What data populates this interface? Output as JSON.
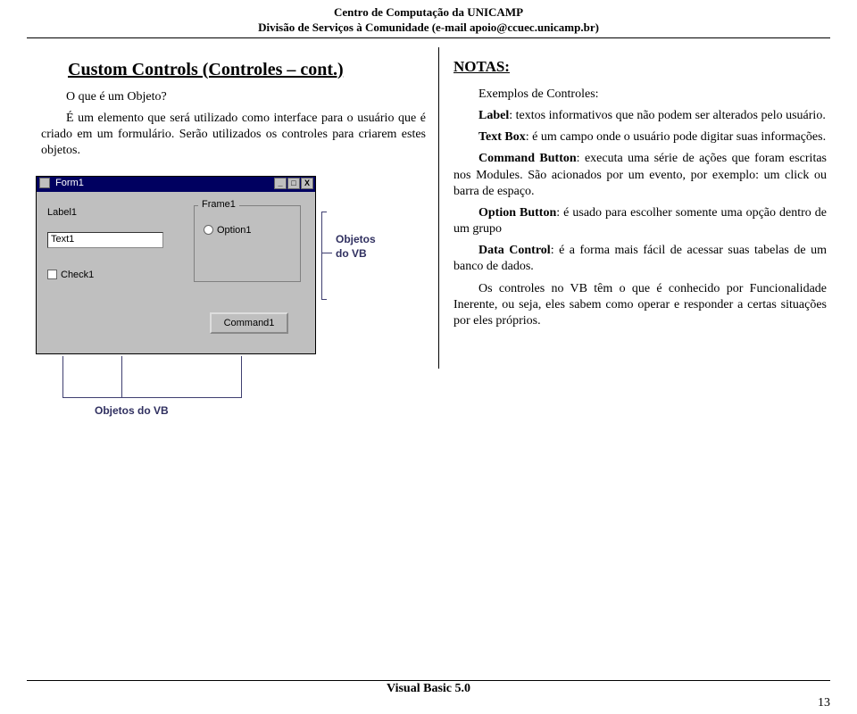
{
  "header": {
    "line1": "Centro de Computação da UNICAMP",
    "line2": "Divisão de Serviços à Comunidade (e-mail apoio@ccuec.unicamp.br)"
  },
  "left": {
    "title": "Custom Controls (Controles – cont.)",
    "q": "O que é um Objeto?",
    "body": "É um elemento que será utilizado como interface para o usuário que é criado em um formulário. Serão utilizados os controles para criarem estes objetos.",
    "shot": {
      "form_title": "Form1",
      "min": "_",
      "max": "□",
      "close": "X",
      "label": "Label1",
      "textbox": "Text1",
      "frame": "Frame1",
      "option": "Option1",
      "check": "Check1",
      "button": "Command1",
      "annot1a": "Objetos",
      "annot1b": "do VB",
      "annot2": "Objetos do VB"
    }
  },
  "right": {
    "title": "NOTAS:",
    "intro": "Exemplos de Controles:",
    "label_b": "Label",
    "label_t": ": textos informativos que não podem ser alterados pelo usuário.",
    "text_b": "Text Box",
    "text_t": ": é um campo onde o usuário pode digitar suas informações.",
    "cmd_b": "Command Button",
    "cmd_t": ": executa uma série de ações que foram escritas nos Modules. São acionados por um evento, por exemplo: um click ou barra de espaço.",
    "opt_b": "Option Button",
    "opt_t": ": é usado para escolher somente uma opção dentro de um grupo",
    "data_b": "Data Control",
    "data_t": ": é a forma mais fácil de acessar suas tabelas de um banco de dados.",
    "last": "Os controles no VB têm o que é conhecido por Funcionalidade Inerente, ou seja, eles sabem como operar e responder a certas situações por eles próprios."
  },
  "footer": {
    "text": "Visual Basic 5.0",
    "page": "13"
  }
}
